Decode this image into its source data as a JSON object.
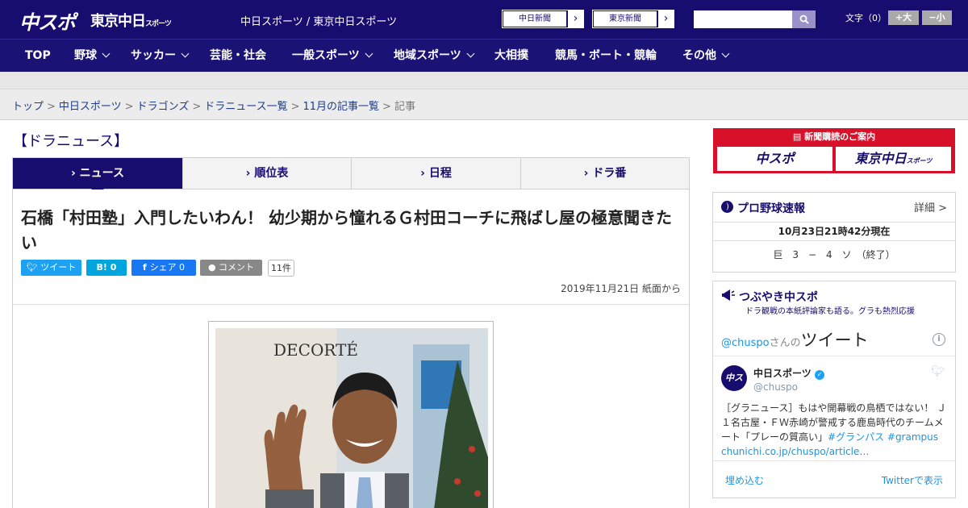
{
  "header": {
    "logo_text": "中スポ",
    "logo2_text": "東京中日",
    "logo2_small": "スポーツ",
    "site_names": "中日スポーツ / 東京中日スポーツ",
    "paper_links": [
      {
        "label": "中日新聞"
      },
      {
        "label": "東京新聞"
      }
    ],
    "search": {
      "value": "",
      "placeholder": ""
    },
    "font_size_label": "文字（0）",
    "font_bigger": "+大",
    "font_smaller": "−小"
  },
  "nav": [
    {
      "label": "TOP",
      "dropdown": false
    },
    {
      "label": "野球",
      "dropdown": true
    },
    {
      "label": "サッカー",
      "dropdown": true
    },
    {
      "label": "芸能・社会",
      "dropdown": false
    },
    {
      "label": "一般スポーツ",
      "dropdown": true
    },
    {
      "label": "地域スポーツ",
      "dropdown": true
    },
    {
      "label": "大相撲",
      "dropdown": false
    },
    {
      "label": "競馬・ボート・競輪",
      "dropdown": false
    },
    {
      "label": "その他",
      "dropdown": true
    }
  ],
  "breadcrumb": {
    "links": [
      "トップ",
      "中日スポーツ",
      "ドラゴンズ",
      "ドラニュース一覧",
      "11月の記事一覧"
    ],
    "current": "記事",
    "separator": ">"
  },
  "section_title": "【ドラニュース】",
  "tabs": [
    {
      "label": "ニュース",
      "active": true
    },
    {
      "label": "順位表",
      "active": false
    },
    {
      "label": "日程",
      "active": false
    },
    {
      "label": "ドラ番",
      "active": false
    }
  ],
  "article": {
    "headline": "石橋「村田塾」入門したいわん！ 幼少期から憧れるＧ村田コーチに飛ばし屋の極意聞きたい",
    "share": {
      "tweet": "ツイート",
      "hatena": "B! 0",
      "facebook": "シェア 0",
      "comment": "コメント",
      "comment_count": "11件"
    },
    "date": "2019年11月21日 紙面から",
    "photo_sign": "DECORTÉ"
  },
  "sidebar": {
    "subscribe": {
      "title": "新聞購読のご案内",
      "logo1": "中スポ",
      "logo2": "東京中日",
      "logo2_small": "スポーツ"
    },
    "baseball": {
      "title": "プロ野球速報",
      "detail": "詳細 >",
      "timestamp": "10月23日21時42分現在",
      "score": "巨　3　−　4　ソ　（終了）"
    },
    "tweets": {
      "title": "つぶやき中スポ",
      "subtitle": "ドラ観戦の本紙評論家も語る。グラも熱烈応援",
      "handle": "@chuspo",
      "handle_suffix": "さんの",
      "tweets_label": "ツイート",
      "account_name": "中日スポーツ",
      "account_handle": "@chuspo",
      "avatar_text": "中スポ",
      "body": "［グラニュース］もはや開幕戦の鳥栖ではない！ Ｊ１名古屋・ＦＷ赤崎が警戒する鹿島時代のチームメート「プレーの質高い」",
      "hashtags": "#グランパス #grampus",
      "link": "chunichi.co.jp/chuspo/article…",
      "embed": "埋め込む",
      "view_on_twitter": "Twitterで表示"
    }
  },
  "colors": {
    "brand": "#170d6e",
    "nav": "#1b1276",
    "twitter": "#1da1f2",
    "hatena": "#00a4de",
    "facebook": "#1877f2",
    "subscribe_red": "#d9102a"
  }
}
